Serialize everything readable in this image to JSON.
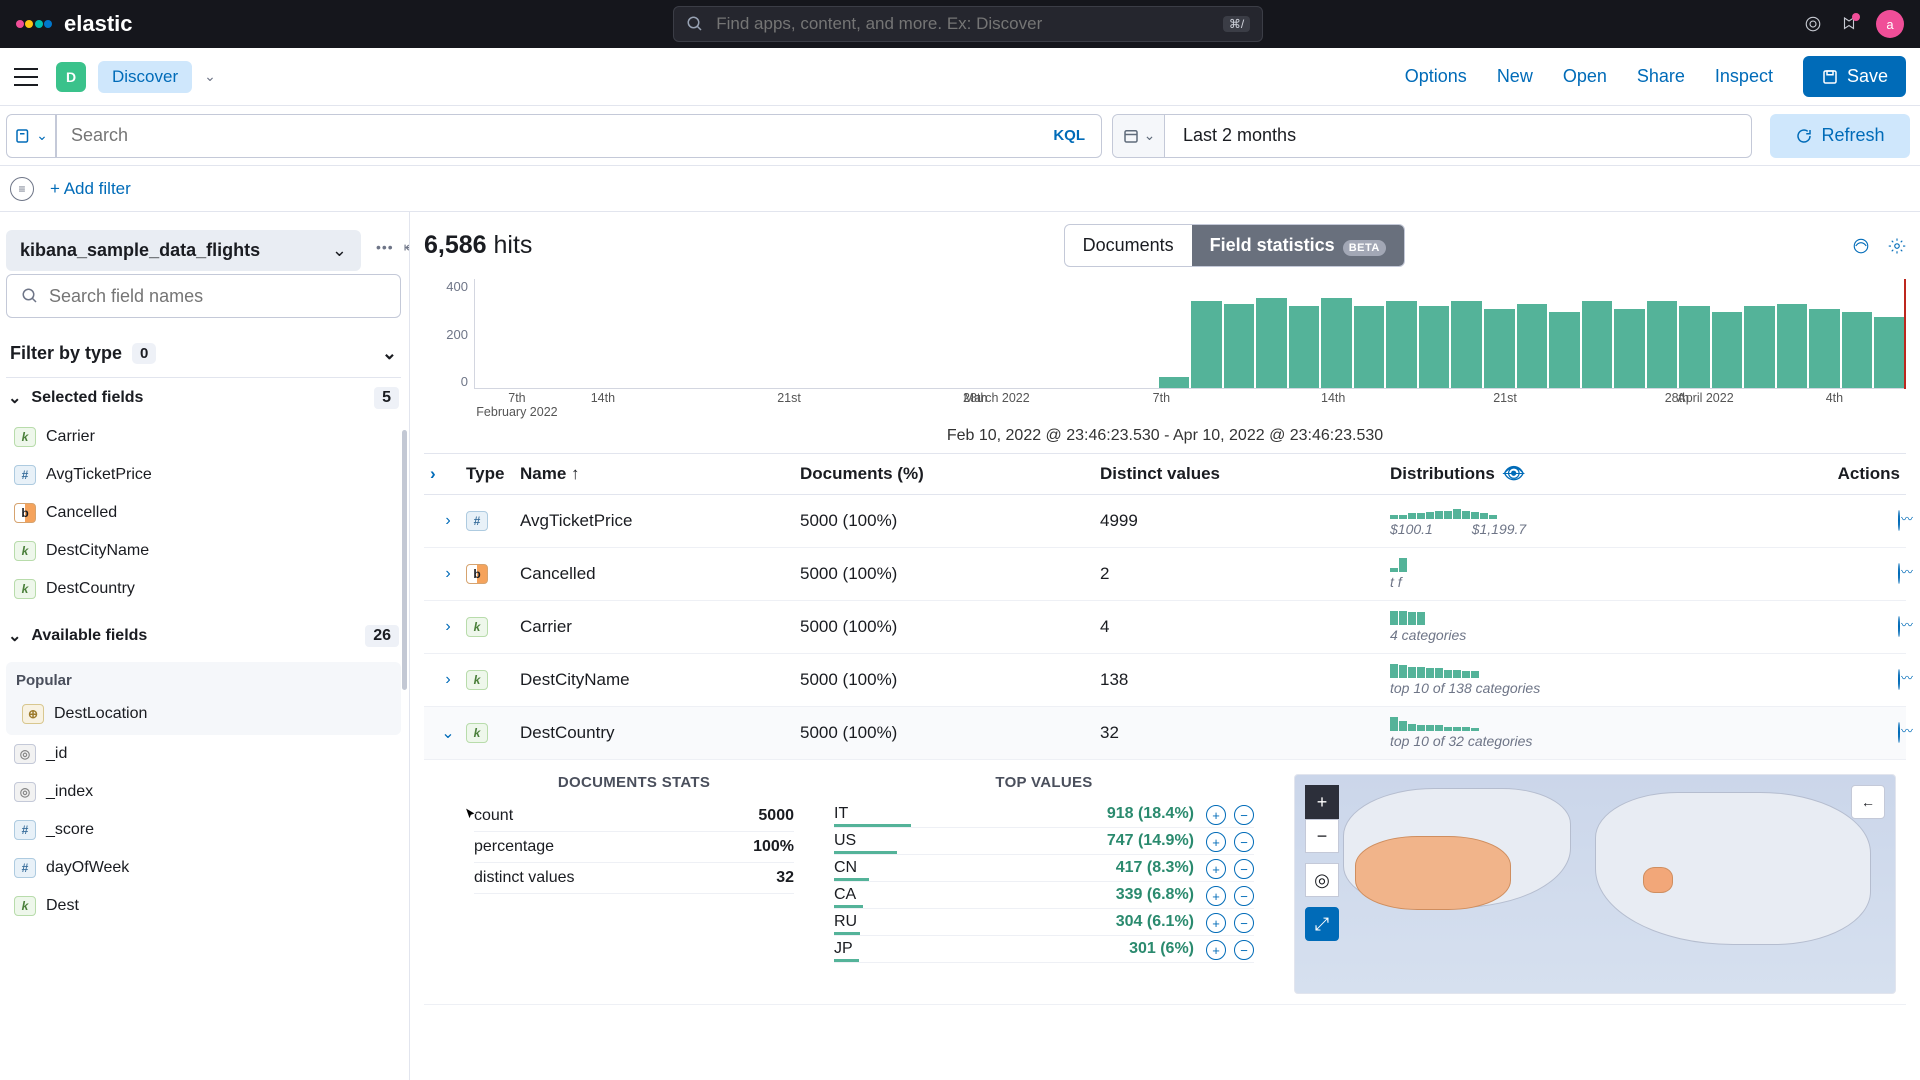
{
  "global_search": {
    "placeholder": "Find apps, content, and more. Ex: Discover",
    "kbd": "⌘/"
  },
  "logo_text": "elastic",
  "avatar_letter": "a",
  "nav": {
    "d_letter": "D",
    "discover": "Discover",
    "options": "Options",
    "new": "New",
    "open": "Open",
    "share": "Share",
    "inspect": "Inspect",
    "save": "Save"
  },
  "query": {
    "placeholder": "Search",
    "kql": "KQL"
  },
  "date": {
    "value": "Last 2 months"
  },
  "refresh": "Refresh",
  "add_filter": "+ Add filter",
  "sidebar": {
    "index": "kibana_sample_data_flights",
    "field_search_ph": "Search field names",
    "filter_by_type": "Filter by type",
    "filter_count": "0",
    "selected_fields": "Selected fields",
    "selected_count": "5",
    "available_fields": "Available fields",
    "available_count": "26",
    "popular": "Popular",
    "selected": [
      {
        "type": "k",
        "name": "Carrier"
      },
      {
        "type": "n",
        "name": "AvgTicketPrice"
      },
      {
        "type": "b",
        "name": "Cancelled"
      },
      {
        "type": "k",
        "name": "DestCityName"
      },
      {
        "type": "k",
        "name": "DestCountry"
      }
    ],
    "popular_items": [
      {
        "type": "g",
        "name": "DestLocation"
      }
    ],
    "available": [
      {
        "type": "c",
        "name": "_id"
      },
      {
        "type": "c",
        "name": "_index"
      },
      {
        "type": "n",
        "name": "_score"
      },
      {
        "type": "n",
        "name": "dayOfWeek"
      },
      {
        "type": "k",
        "name": "Dest"
      }
    ]
  },
  "hits_num": "6,586",
  "hits_word": "hits",
  "tabs": {
    "documents": "Documents",
    "fieldstats": "Field statistics",
    "beta": "BETA"
  },
  "timerange": "Feb 10, 2022 @ 23:46:23.530 - Apr 10, 2022 @ 23:46:23.530",
  "yticks": [
    "400",
    "200",
    "0"
  ],
  "xticks": [
    {
      "pct": 3,
      "l1": "7th",
      "l2": "February 2022"
    },
    {
      "pct": 9,
      "l1": "14th",
      "l2": ""
    },
    {
      "pct": 22,
      "l1": "21st",
      "l2": ""
    },
    {
      "pct": 35,
      "l1": "28th",
      "l2": ""
    },
    {
      "pct": 36.5,
      "l1": "",
      "l2": "March 2022"
    },
    {
      "pct": 48,
      "l1": "7th",
      "l2": ""
    },
    {
      "pct": 60,
      "l1": "14th",
      "l2": ""
    },
    {
      "pct": 72,
      "l1": "21st",
      "l2": ""
    },
    {
      "pct": 84,
      "l1": "28th",
      "l2": ""
    },
    {
      "pct": 86,
      "l1": "",
      "l2": "April 2022"
    },
    {
      "pct": 95,
      "l1": "4th",
      "l2": ""
    }
  ],
  "table_head": {
    "type": "Type",
    "name": "Name",
    "docs": "Documents (%)",
    "distinct": "Distinct values",
    "distrib": "Distributions",
    "actions": "Actions"
  },
  "rows": [
    {
      "type": "n",
      "name": "AvgTicketPrice",
      "docs": "5000 (100%)",
      "distinct": "4999",
      "sub": "$100.1        $1,199.7",
      "bars": [
        3,
        3,
        4,
        4,
        5,
        6,
        6,
        7,
        6,
        5,
        4,
        3
      ]
    },
    {
      "type": "b",
      "name": "Cancelled",
      "docs": "5000 (100%)",
      "distinct": "2",
      "sub": "t  f",
      "bars": [
        3,
        10
      ]
    },
    {
      "type": "k",
      "name": "Carrier",
      "docs": "5000 (100%)",
      "distinct": "4",
      "sub": "4 categories",
      "bars": [
        10,
        10,
        9,
        9
      ]
    },
    {
      "type": "k",
      "name": "DestCityName",
      "docs": "5000 (100%)",
      "distinct": "138",
      "sub": "top 10 of 138 categories",
      "bars": [
        10,
        9,
        8,
        8,
        7,
        7,
        6,
        6,
        5,
        5
      ]
    },
    {
      "type": "k",
      "name": "DestCountry",
      "docs": "5000 (100%)",
      "distinct": "32",
      "sub": "top 10 of 32 categories",
      "bars": [
        10,
        7,
        5,
        4,
        4,
        4,
        3,
        3,
        3,
        2
      ],
      "expanded": true
    }
  ],
  "expanded": {
    "doc_title": "DOCUMENTS STATS",
    "stats": [
      {
        "k": "count",
        "v": "5000"
      },
      {
        "k": "percentage",
        "v": "100%"
      },
      {
        "k": "distinct values",
        "v": "32"
      }
    ],
    "tv_title": "TOP VALUES",
    "top": [
      {
        "k": "IT",
        "v": "918 (18.4%)",
        "pct": 18.4
      },
      {
        "k": "US",
        "v": "747 (14.9%)",
        "pct": 14.9
      },
      {
        "k": "CN",
        "v": "417 (8.3%)",
        "pct": 8.3
      },
      {
        "k": "CA",
        "v": "339 (6.8%)",
        "pct": 6.8
      },
      {
        "k": "RU",
        "v": "304 (6.1%)",
        "pct": 6.1
      },
      {
        "k": "JP",
        "v": "301 (6%)",
        "pct": 6.0
      }
    ]
  },
  "chart_data": {
    "type": "bar",
    "title": "",
    "xlabel": "",
    "ylabel": "",
    "ylim": [
      0,
      400
    ],
    "note": "document count histogram over time; empty until ~Mar 20 2022 then ~280-340/bucket",
    "categories_bucket": "per ~2 days, Feb 7 – Apr 10 2022",
    "values": [
      0,
      0,
      0,
      0,
      0,
      0,
      0,
      0,
      0,
      0,
      0,
      0,
      0,
      0,
      0,
      0,
      0,
      0,
      0,
      0,
      0,
      40,
      320,
      310,
      330,
      300,
      330,
      300,
      320,
      300,
      320,
      290,
      310,
      280,
      320,
      290,
      320,
      300,
      280,
      300,
      310,
      290,
      280,
      260
    ]
  }
}
